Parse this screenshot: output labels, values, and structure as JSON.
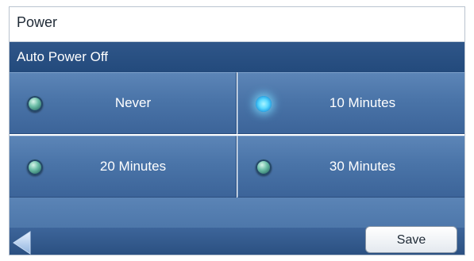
{
  "header": {
    "title": "Power"
  },
  "section": {
    "title": "Auto Power Off"
  },
  "options": [
    {
      "label": "Never",
      "selected": false
    },
    {
      "label": "10 Minutes",
      "selected": true
    },
    {
      "label": "20 Minutes",
      "selected": false
    },
    {
      "label": "30 Minutes",
      "selected": false
    }
  ],
  "footer": {
    "save_label": "Save",
    "back_icon": "left-triangle-icon"
  },
  "colors": {
    "section_bar": "#234a7c",
    "option_bg": "#4a74a8",
    "radio_selected": "#5bd9ff",
    "radio_unselected": "#2b6e66"
  }
}
